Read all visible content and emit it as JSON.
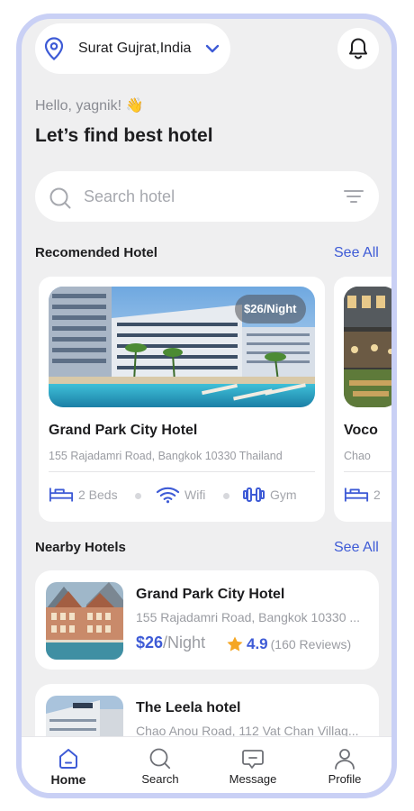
{
  "location": {
    "text": "Surat Gujrat,India"
  },
  "greeting": "Hello, yagnik! 👋",
  "headline": "Let’s find best hotel",
  "search": {
    "placeholder": "Search hotel"
  },
  "recommended": {
    "title": "Recomended Hotel",
    "see_all": "See All",
    "cards": [
      {
        "price": "$26/Night",
        "name": "Grand Park City Hotel",
        "address": "155 Rajadamri Road, Bangkok 10330 Thailand",
        "amenities": [
          "2 Beds",
          "Wifi",
          "Gym"
        ]
      },
      {
        "name": "Voco",
        "address": "Chao",
        "amenities": [
          "2"
        ]
      }
    ]
  },
  "nearby": {
    "title": "Nearby Hotels",
    "see_all": "See All",
    "items": [
      {
        "name": "Grand Park City Hotel",
        "address": "155 Rajadamri Road, Bangkok 10330 ...",
        "price": "$26",
        "per": "/Night",
        "rating": "4.9",
        "reviews": "(160 Reviews)"
      },
      {
        "name": "The Leela hotel",
        "address": "Chao Anou Road, 112 Vat Chan Villag..."
      }
    ]
  },
  "nav": {
    "items": [
      {
        "label": "Home",
        "icon": "home-icon",
        "active": true
      },
      {
        "label": "Search",
        "icon": "search-icon",
        "active": false
      },
      {
        "label": "Message",
        "icon": "message-icon",
        "active": false
      },
      {
        "label": "Profile",
        "icon": "profile-icon",
        "active": false
      }
    ]
  },
  "colors": {
    "accent": "#3e5bd6",
    "star": "#f5a623",
    "frame": "#c9d0f5",
    "background": "#efeff0"
  }
}
